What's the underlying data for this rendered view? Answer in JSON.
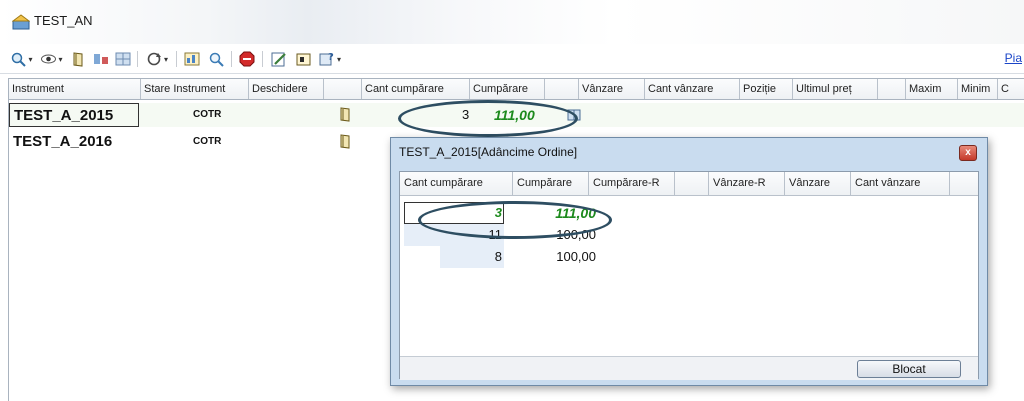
{
  "window": {
    "title": "TEST_AN"
  },
  "toolbar": {
    "link_label": "Pia",
    "icons": [
      "magnifier-icon",
      "eye-icon",
      "book-icon",
      "bar-chart-icon",
      "grid-icon",
      "refresh-icon",
      "chart-icon",
      "zoom-icon",
      "stop-icon",
      "edit-icon",
      "window-icon",
      "help-icon"
    ]
  },
  "grid": {
    "columns": [
      "Instrument",
      "Stare Instrument",
      "Deschidere",
      "",
      "Cant cumpărare",
      "Cumpărare",
      "",
      "Vânzare",
      "Cant vânzare",
      "Poziție",
      "Ultimul preț",
      "",
      "Maxim",
      "Minim",
      "C"
    ],
    "rows": [
      {
        "instrument": "TEST_A_2015",
        "state": "COTR",
        "bid_qty": "3",
        "bid": "111,00"
      },
      {
        "instrument": "TEST_A_2016",
        "state": "COTR"
      }
    ]
  },
  "depth_dialog": {
    "title": "TEST_A_2015[Adâncime Ordine]",
    "close_label": "x",
    "columns": [
      "Cant cumpărare",
      "Cumpărare",
      "Cumpărare-R",
      "",
      "Vânzare-R",
      "Vânzare",
      "Cant vânzare"
    ],
    "rows": [
      {
        "qty": "3",
        "price": "111,00"
      },
      {
        "qty": "11",
        "price": "100,00"
      },
      {
        "qty": "8",
        "price": "100,00"
      }
    ],
    "button_label": "Blocat"
  },
  "colors": {
    "highlight_price": "#1d8a1d",
    "annotation_ellipse": "#2e4e62",
    "dialog_frame": "#c9dcef"
  }
}
